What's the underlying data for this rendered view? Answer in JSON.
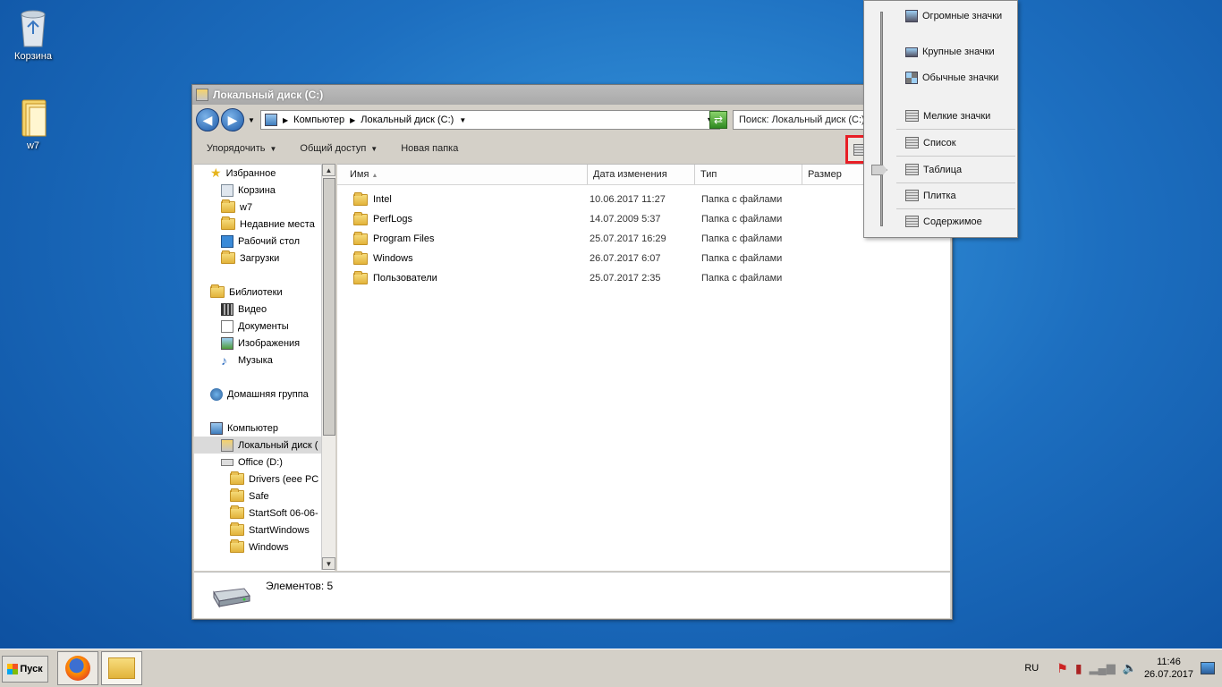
{
  "desktop": {
    "icons": [
      {
        "label": "Корзина"
      },
      {
        "label": "w7"
      }
    ]
  },
  "window": {
    "title": "Локальный диск (C:)",
    "address": {
      "segments": [
        "Компьютер",
        "Локальный диск (C:)"
      ]
    },
    "search_placeholder": "Поиск: Локальный диск (C:)",
    "toolbar": {
      "organize": "Упорядочить",
      "share": "Общий доступ",
      "new_folder": "Новая папка"
    },
    "nav": {
      "favorites": "Избранное",
      "fav_items": [
        "Корзина",
        "w7",
        "Недавние места",
        "Рабочий стол",
        "Загрузки"
      ],
      "libraries": "Библиотеки",
      "lib_items": [
        "Видео",
        "Документы",
        "Изображения",
        "Музыка"
      ],
      "homegroup": "Домашняя группа",
      "computer": "Компьютер",
      "drive_c": "Локальный диск (",
      "drive_d": "Office (D:)",
      "d_items": [
        "Drivers (eee PC",
        "Safe",
        "StartSoft 06-06-",
        "StartWindows",
        "Windows"
      ]
    },
    "columns": {
      "name": "Имя",
      "date": "Дата изменения",
      "type": "Тип",
      "size": "Размер"
    },
    "files": [
      {
        "name": "Intel",
        "date": "10.06.2017 11:27",
        "type": "Папка с файлами"
      },
      {
        "name": "PerfLogs",
        "date": "14.07.2009 5:37",
        "type": "Папка с файлами"
      },
      {
        "name": "Program Files",
        "date": "25.07.2017 16:29",
        "type": "Папка с файлами"
      },
      {
        "name": "Windows",
        "date": "26.07.2017 6:07",
        "type": "Папка с файлами"
      },
      {
        "name": "Пользователи",
        "date": "25.07.2017 2:35",
        "type": "Папка с файлами"
      }
    ],
    "status": "Элементов: 5"
  },
  "view_menu": {
    "items": [
      "Огромные значки",
      "Крупные значки",
      "Обычные значки",
      "Мелкие значки",
      "Список",
      "Таблица",
      "Плитка",
      "Содержимое"
    ],
    "selected": "Таблица"
  },
  "taskbar": {
    "start": "Пуск",
    "lang": "RU",
    "time": "11:46",
    "date": "26.07.2017"
  },
  "colors": {
    "highlight": "#e81e25",
    "desktop": "#1d6fc0"
  }
}
